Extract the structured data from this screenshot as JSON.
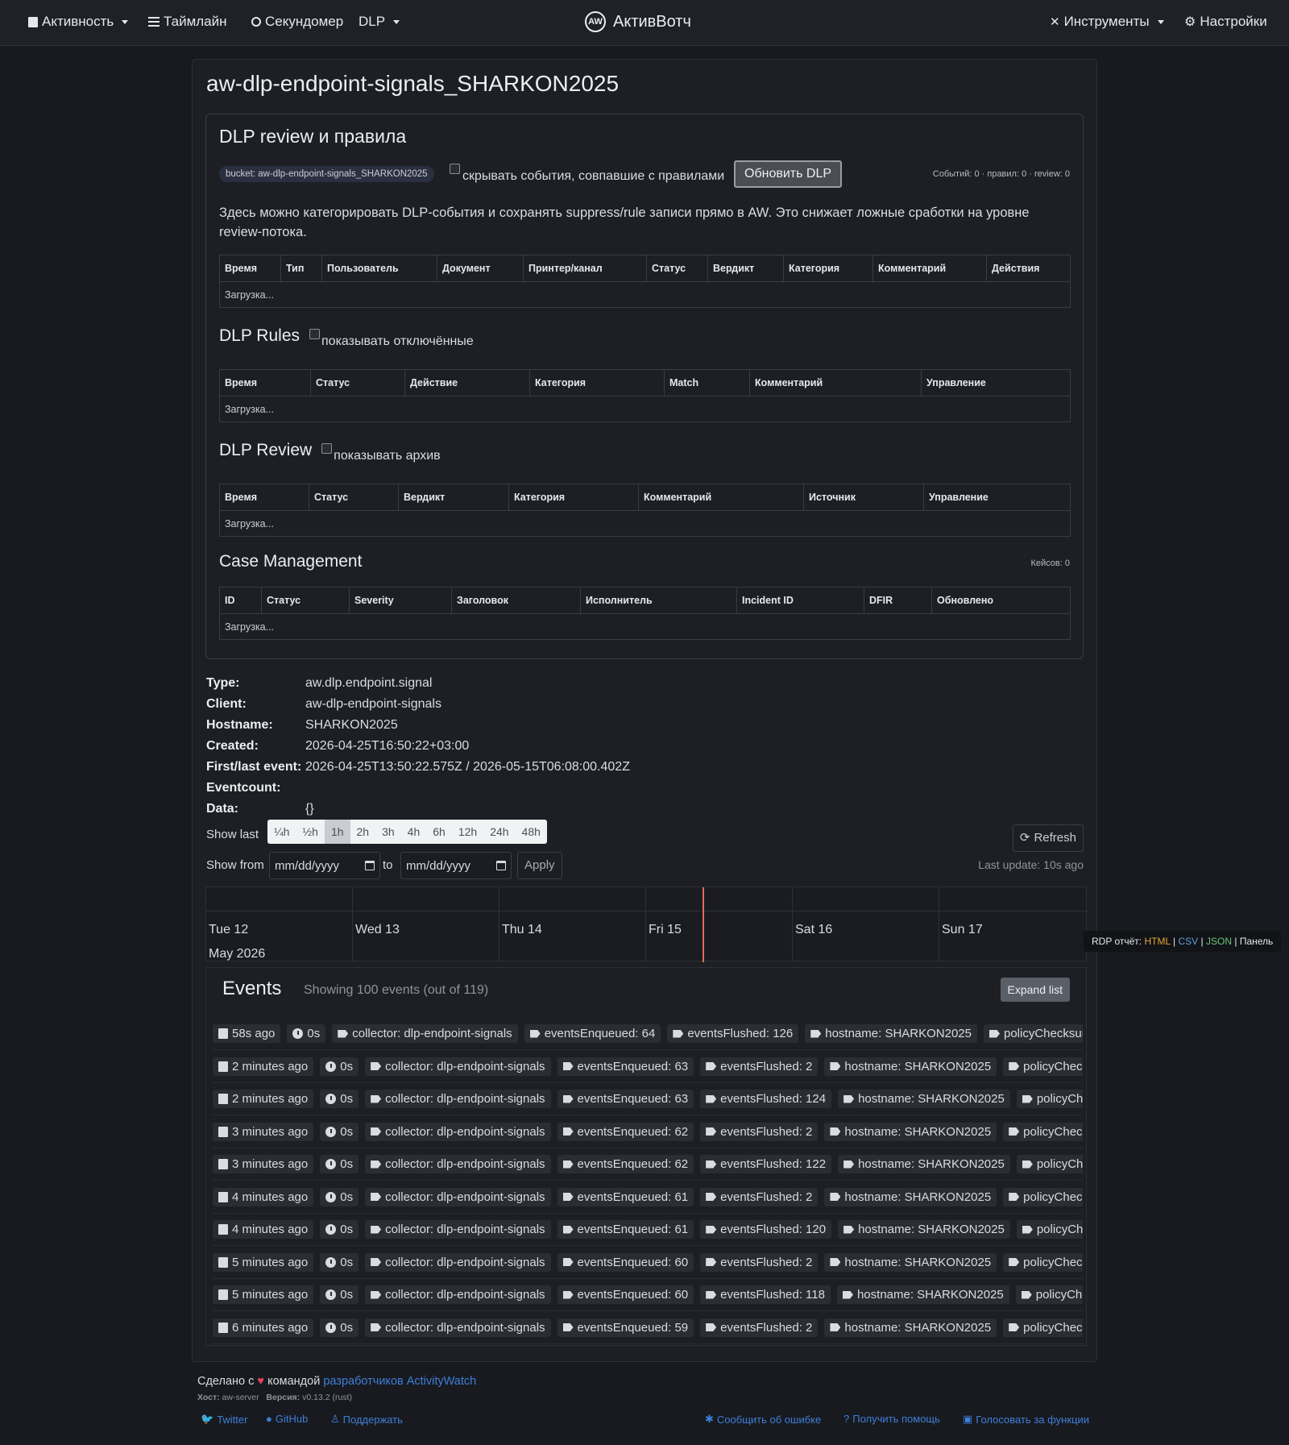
{
  "nav": {
    "activity": "Активность",
    "timeline": "Таймлайн",
    "stopwatch": "Секундомер",
    "dlp": "DLP",
    "brand": "АктивВотч",
    "tools": "Инструменты",
    "settings": "Настройки"
  },
  "page": {
    "title": "aw-dlp-endpoint-signals_SHARKON2025"
  },
  "dlp_review": {
    "heading": "DLP review и правила",
    "bucket_badge": "bucket: aw-dlp-endpoint-signals_SHARKON2025",
    "hide_matched_label": "скрывать события, совпавшие с правилами",
    "refresh_button": "Обновить DLP",
    "counts": "Событий: 0 · правил: 0 · review: 0",
    "description": "Здесь можно категорировать DLP-события и сохранять suppress/rule записи прямо в AW. Это снижает ложные сработки на уровне review-потока.",
    "events_table": {
      "columns": [
        "Время",
        "Тип",
        "Пользователь",
        "Документ",
        "Принтер/канал",
        "Статус",
        "Вердикт",
        "Категория",
        "Комментарий",
        "Действия"
      ],
      "loading": "Загрузка..."
    },
    "rules": {
      "heading": "DLP Rules",
      "show_disabled_label": "показывать отключённые",
      "columns": [
        "Время",
        "Статус",
        "Действие",
        "Категория",
        "Match",
        "Комментарий",
        "Управление"
      ],
      "loading": "Загрузка..."
    },
    "review": {
      "heading": "DLP Review",
      "show_archive_label": "показывать архив",
      "columns": [
        "Время",
        "Статус",
        "Вердикт",
        "Категория",
        "Комментарий",
        "Источник",
        "Управление"
      ],
      "loading": "Загрузка..."
    },
    "cases": {
      "heading": "Case Management",
      "count": "Кейсов: 0",
      "columns": [
        "ID",
        "Статус",
        "Severity",
        "Заголовок",
        "Исполнитель",
        "Incident ID",
        "DFIR",
        "Обновлено"
      ],
      "loading": "Загрузка..."
    }
  },
  "bucket_meta": {
    "type_key": "Type:",
    "type_val": "aw.dlp.endpoint.signal",
    "client_key": "Client:",
    "client_val": "aw-dlp-endpoint-signals",
    "hostname_key": "Hostname:",
    "hostname_val": "SHARKON2025",
    "created_key": "Created:",
    "created_val": "2026-04-25T16:50:22+03:00",
    "firstlast_key": "First/last event:",
    "firstlast_val": "2026-04-25T13:50:22.575Z / 2026-05-15T06:08:00.402Z",
    "eventcount_key": "Eventcount:",
    "eventcount_val": "",
    "data_key": "Data:",
    "data_val": "{}"
  },
  "controls": {
    "show_last_label": "Show last",
    "ranges": [
      "¼h",
      "½h",
      "1h",
      "2h",
      "3h",
      "4h",
      "6h",
      "12h",
      "24h",
      "48h"
    ],
    "active_range": "1h",
    "refresh": "Refresh",
    "show_from_label": "Show from",
    "date_placeholder_from": "mm/dd/yyyy",
    "to_label": "to",
    "date_placeholder_to": "mm/dd/yyyy",
    "apply": "Apply",
    "last_update": "Last update: 10s ago"
  },
  "timeline": {
    "days": [
      "Tue 12",
      "Wed 13",
      "Thu 14",
      "Fri 15",
      "Sat 16",
      "Sun 17"
    ],
    "month": "May 2026",
    "marker_color": "#e06c5a"
  },
  "rdp": {
    "label": "RDP отчёт:",
    "html": "HTML",
    "csv": "CSV",
    "json": "JSON",
    "panel": "Панель",
    "sep": "|"
  },
  "events": {
    "heading": "Events",
    "showing": "Showing 100 events (out of 119)",
    "expand": "Expand list",
    "rows": [
      {
        "ago": "58s ago",
        "dur": "0s",
        "collector": "collector: dlp-endpoint-signals",
        "enq": "eventsEnqueued: 64",
        "flushed": "eventsFlushed: 126",
        "host": "hostname: SHARKON2025",
        "policy": "policyChecksum:"
      },
      {
        "ago": "2 minutes ago",
        "dur": "0s",
        "collector": "collector: dlp-endpoint-signals",
        "enq": "eventsEnqueued: 63",
        "flushed": "eventsFlushed: 2",
        "host": "hostname: SHARKON2025",
        "policy": "policyChecks"
      },
      {
        "ago": "2 minutes ago",
        "dur": "0s",
        "collector": "collector: dlp-endpoint-signals",
        "enq": "eventsEnqueued: 63",
        "flushed": "eventsFlushed: 124",
        "host": "hostname: SHARKON2025",
        "policy": "policyChec"
      },
      {
        "ago": "3 minutes ago",
        "dur": "0s",
        "collector": "collector: dlp-endpoint-signals",
        "enq": "eventsEnqueued: 62",
        "flushed": "eventsFlushed: 2",
        "host": "hostname: SHARKON2025",
        "policy": "policyChecks"
      },
      {
        "ago": "3 minutes ago",
        "dur": "0s",
        "collector": "collector: dlp-endpoint-signals",
        "enq": "eventsEnqueued: 62",
        "flushed": "eventsFlushed: 122",
        "host": "hostname: SHARKON2025",
        "policy": "policyChec"
      },
      {
        "ago": "4 minutes ago",
        "dur": "0s",
        "collector": "collector: dlp-endpoint-signals",
        "enq": "eventsEnqueued: 61",
        "flushed": "eventsFlushed: 2",
        "host": "hostname: SHARKON2025",
        "policy": "policyChecks"
      },
      {
        "ago": "4 minutes ago",
        "dur": "0s",
        "collector": "collector: dlp-endpoint-signals",
        "enq": "eventsEnqueued: 61",
        "flushed": "eventsFlushed: 120",
        "host": "hostname: SHARKON2025",
        "policy": "policyChec"
      },
      {
        "ago": "5 minutes ago",
        "dur": "0s",
        "collector": "collector: dlp-endpoint-signals",
        "enq": "eventsEnqueued: 60",
        "flushed": "eventsFlushed: 2",
        "host": "hostname: SHARKON2025",
        "policy": "policyChecks"
      },
      {
        "ago": "5 minutes ago",
        "dur": "0s",
        "collector": "collector: dlp-endpoint-signals",
        "enq": "eventsEnqueued: 60",
        "flushed": "eventsFlushed: 118",
        "host": "hostname: SHARKON2025",
        "policy": "policyChec"
      },
      {
        "ago": "6 minutes ago",
        "dur": "0s",
        "collector": "collector: dlp-endpoint-signals",
        "enq": "eventsEnqueued: 59",
        "flushed": "eventsFlushed: 2",
        "host": "hostname: SHARKON2025",
        "policy": "policyChecks"
      }
    ]
  },
  "footer": {
    "made_with": "Сделано с",
    "by_team": "командой",
    "devs_link": "разработчиков ActivityWatch",
    "host_key": "Хост:",
    "host_val": "aw-server",
    "version_key": "Версия:",
    "version_val": "v0.13.2 (rust)",
    "twitter": "Twitter",
    "github": "GitHub",
    "support": "Поддержать",
    "report_bug": "Сообщить об ошибке",
    "get_help": "Получить помощь",
    "vote": "Голосовать за функции"
  }
}
